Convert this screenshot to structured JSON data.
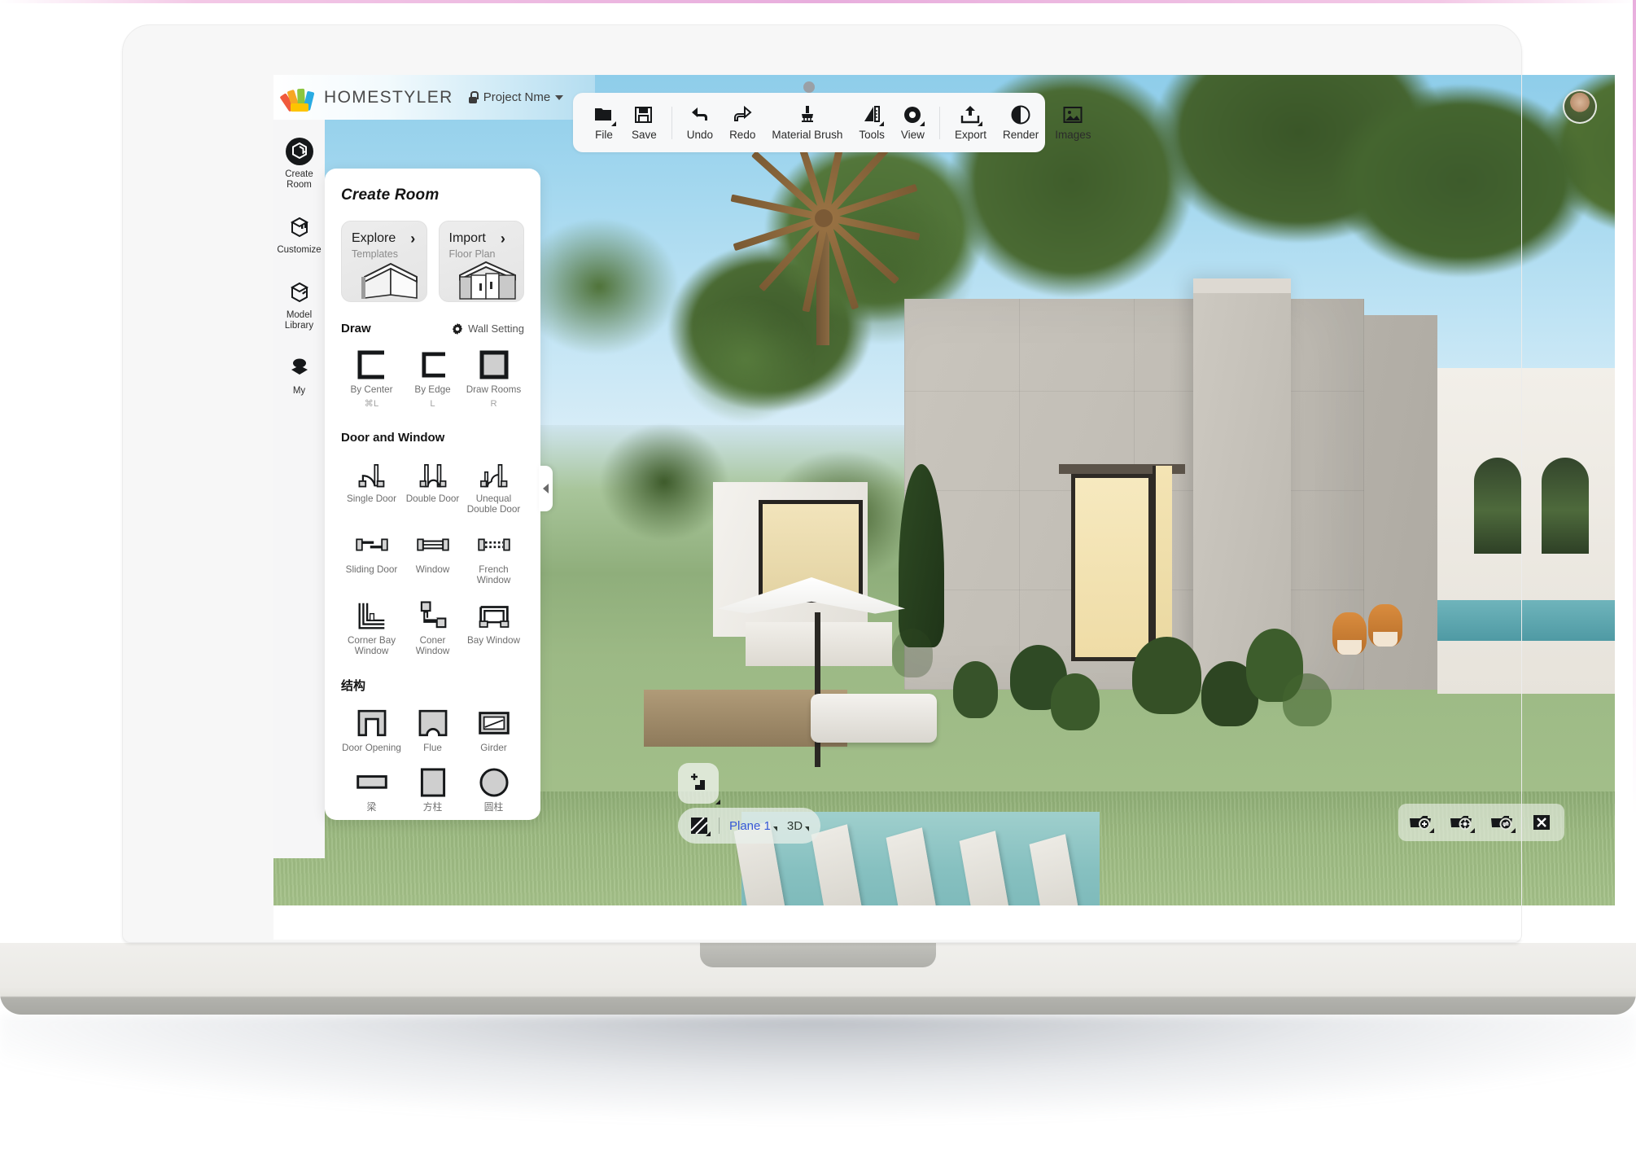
{
  "app": {
    "brand": "HOMESTYLER",
    "project_name": "Project Nme",
    "lock_icon": "lock-icon",
    "logo_icon": "homestyler-logo-icon",
    "chevron_icon": "chevron-down-icon",
    "avatar": "user-avatar"
  },
  "toolbar": {
    "items": [
      {
        "label": "File",
        "icon": "folder-icon",
        "has_caret": true
      },
      {
        "label": "Save",
        "icon": "floppy-disk-icon",
        "has_caret": false
      },
      {
        "label": "Undo",
        "icon": "undo-arrow-icon",
        "has_caret": false
      },
      {
        "label": "Redo",
        "icon": "redo-arrow-icon",
        "has_caret": false
      },
      {
        "label": "Material Brush",
        "icon": "paint-brush-icon",
        "has_caret": false
      },
      {
        "label": "Tools",
        "icon": "ruler-icon",
        "has_caret": true
      },
      {
        "label": "View",
        "icon": "eye-camera-icon",
        "has_caret": true
      },
      {
        "label": "Export",
        "icon": "export-upload-icon",
        "has_caret": true
      },
      {
        "label": "Render",
        "icon": "render-circle-icon",
        "has_caret": false
      },
      {
        "label": "Images",
        "icon": "images-icon",
        "has_caret": false
      }
    ]
  },
  "rail": {
    "items": [
      {
        "label": "Create Room",
        "icon": "create-room-icon",
        "active": true
      },
      {
        "label": "Customize",
        "icon": "customize-cube-icon",
        "active": false
      },
      {
        "label": "Model Library",
        "icon": "model-library-icon",
        "active": false
      },
      {
        "label": "My",
        "icon": "my-stack-icon",
        "active": false
      }
    ]
  },
  "panel": {
    "title": "Create Room",
    "cards": [
      {
        "title": "Explore",
        "subtitle": "Templates",
        "art": "room-corner-art"
      },
      {
        "title": "Import",
        "subtitle": "Floor Plan",
        "art": "floorplan-art"
      }
    ],
    "draw": {
      "heading": "Draw",
      "wall_setting_label": "Wall Setting",
      "wall_setting_icon": "gear-icon",
      "tools": [
        {
          "label": "By Center",
          "shortcut": "⌘L",
          "icon": "wall-by-center-icon"
        },
        {
          "label": "By Edge",
          "shortcut": "L",
          "icon": "wall-by-edge-icon"
        },
        {
          "label": "Draw Rooms",
          "shortcut": "R",
          "icon": "draw-rooms-icon"
        }
      ]
    },
    "door_window": {
      "heading": "Door and Window",
      "tools": [
        {
          "label": "Single Door",
          "icon": "single-door-icon"
        },
        {
          "label": "Double Door",
          "icon": "double-door-icon"
        },
        {
          "label": "Unequal Double Door",
          "icon": "unequal-double-door-icon"
        },
        {
          "label": "Sliding Door",
          "icon": "sliding-door-icon"
        },
        {
          "label": "Window",
          "icon": "window-icon"
        },
        {
          "label": "French Window",
          "icon": "french-window-icon"
        },
        {
          "label": "Corner Bay Window",
          "icon": "corner-bay-window-icon"
        },
        {
          "label": "Coner Window",
          "icon": "corner-window-icon"
        },
        {
          "label": "Bay Window",
          "icon": "bay-window-icon"
        }
      ]
    },
    "structure": {
      "heading": "结构",
      "tools": [
        {
          "label": "Door Opening",
          "icon": "door-opening-icon"
        },
        {
          "label": "Flue",
          "icon": "flue-icon"
        },
        {
          "label": "Girder",
          "icon": "girder-icon"
        },
        {
          "label": "梁",
          "icon": "beam-icon"
        },
        {
          "label": "方柱",
          "icon": "square-column-icon"
        },
        {
          "label": "圆柱",
          "icon": "round-column-icon"
        }
      ]
    },
    "collapse_icon": "collapse-panel-arrow-icon"
  },
  "viewport_controls": {
    "left": {
      "add_level_icon": "add-level-icon",
      "hatch_icon": "section-hatch-icon",
      "plane_label": "Plane 1",
      "view_mode_label": "3D"
    },
    "right": {
      "buttons": [
        {
          "icon": "camera-add-icon"
        },
        {
          "icon": "camera-settings-icon"
        },
        {
          "icon": "camera-swap-icon"
        },
        {
          "icon": "close-x-icon"
        }
      ]
    }
  },
  "colors": {
    "accent_blue": "#3558d6",
    "panel_bg": "#ffffff",
    "rail_bg": "#f6f6f7",
    "toolbar_bg": "#f7f8f9",
    "header_gradient_end": "#b4ddf0"
  }
}
